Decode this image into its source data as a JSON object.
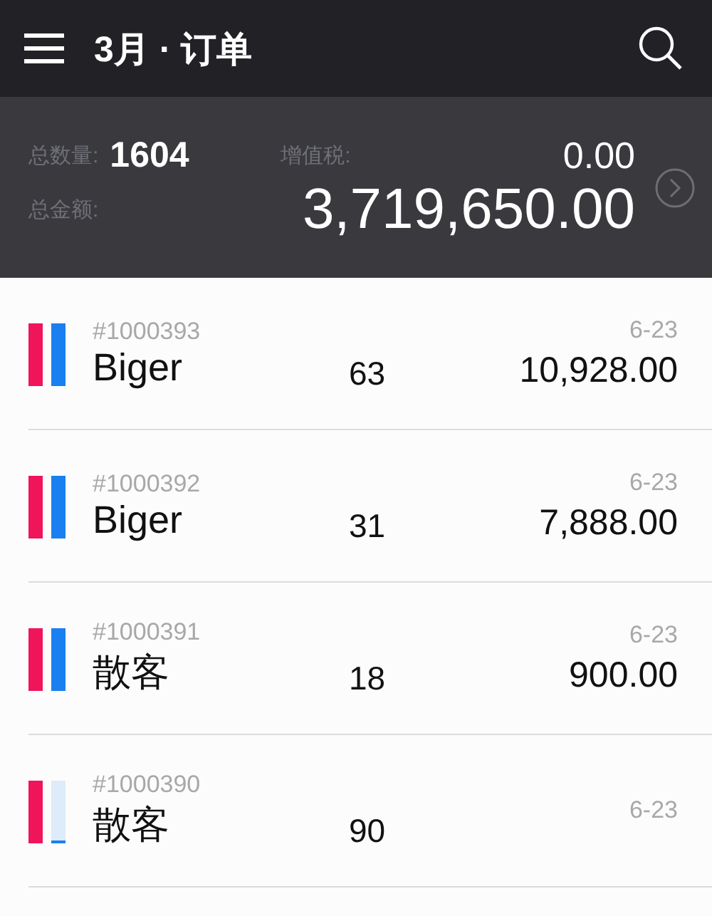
{
  "header": {
    "title": "3月 · 订单"
  },
  "summary": {
    "count_label": "总数量:",
    "count": "1604",
    "tax_label": "增值税:",
    "tax": "0.00",
    "total_label": "总金额:",
    "total": "3,719,650.00"
  },
  "orders": [
    {
      "id": "#1000393",
      "customer": "Biger",
      "quantity": "63",
      "date": "6-23",
      "amount": "10,928.00",
      "bars": [
        {
          "color": "#f0145a",
          "level": 1
        },
        {
          "color": "#1a7ff0",
          "level": 1
        }
      ]
    },
    {
      "id": "#1000392",
      "customer": "Biger",
      "quantity": "31",
      "date": "6-23",
      "amount": "7,888.00",
      "bars": [
        {
          "color": "#f0145a",
          "level": 1
        },
        {
          "color": "#1a7ff0",
          "level": 1
        }
      ]
    },
    {
      "id": "#1000391",
      "customer": "散客",
      "quantity": "18",
      "date": "6-23",
      "amount": "900.00",
      "bars": [
        {
          "color": "#f0145a",
          "level": 1
        },
        {
          "color": "#1a7ff0",
          "level": 1
        }
      ]
    },
    {
      "id": "#1000390",
      "customer": "散客",
      "quantity": "90",
      "date": "6-23",
      "bars": [
        {
          "color": "#f0145a",
          "level": 1
        },
        {
          "color": "#1a7ff0",
          "level": 0.04
        }
      ]
    }
  ]
}
